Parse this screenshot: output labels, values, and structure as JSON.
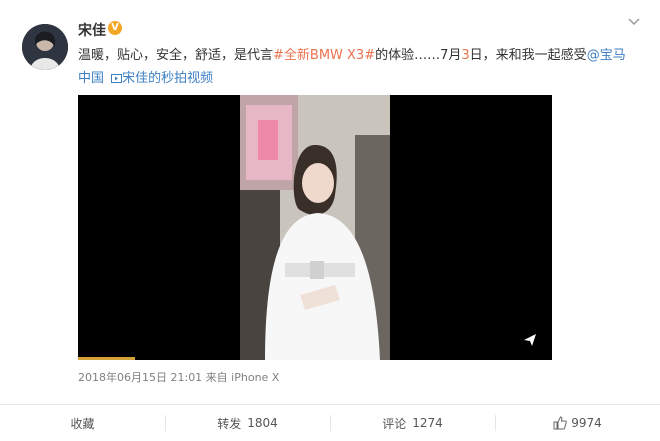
{
  "user": {
    "name": "宋佳",
    "badge": "V"
  },
  "post": {
    "text_a": "温暖，贴心，安全，舒适，是代言",
    "hashtag": "#全新BMW X3#",
    "text_b": "的体验……7月",
    "date_num": "3",
    "text_c": "日，来和我一起感受",
    "mention": "@宝马中国",
    "video_link": "宋佳的秒拍视频"
  },
  "meta": {
    "time": "2018年06月15日 21:01",
    "via": "来自 iPhone X"
  },
  "actions": {
    "favorite_label": "收藏",
    "repost_label": "转发",
    "repost_count": "1804",
    "comment_label": "评论",
    "comment_count": "1274",
    "like_count": "9974"
  },
  "video": {
    "progress": 0.12
  },
  "colors": {
    "link": "#eb7350",
    "mention": "#3d7fc3",
    "badge": "#f5a623",
    "progress": "#d4a13a"
  },
  "icons": [
    "more-chevron-icon",
    "verified-badge-icon",
    "video-link-icon",
    "share-icon",
    "like-thumb-icon"
  ]
}
